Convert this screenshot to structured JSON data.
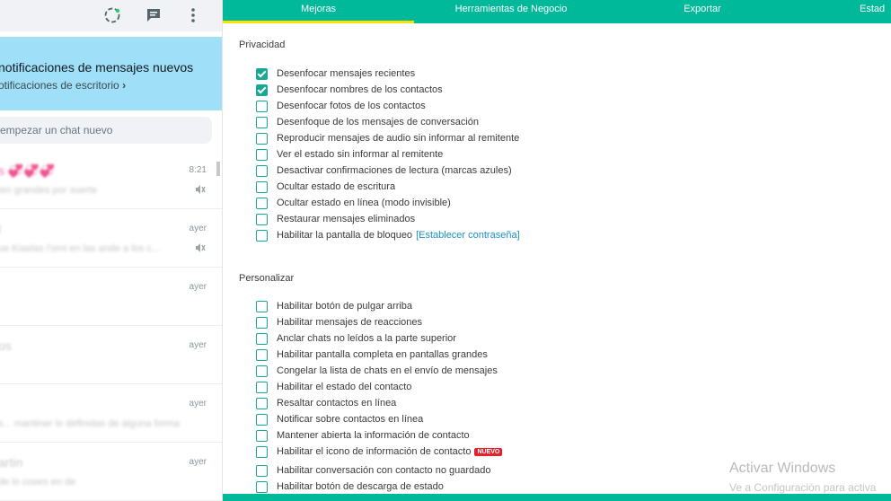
{
  "left": {
    "notification": {
      "title": "notificaciones de mensajes nuevos",
      "link": "otificaciones de escritorio",
      "chevron": "›"
    },
    "search": {
      "placeholder": "empezar un chat nuevo"
    },
    "chats": [
      {
        "name": "s 💞💞💞",
        "message": "ien grandes por suerte",
        "time": "8:21",
        "muted": true
      },
      {
        "name": "l",
        "message": "ue Kiaslas l'omi en las ande a los c... ",
        "time": "ayer",
        "muted": true
      },
      {
        "name": "",
        "message": "",
        "time": "ayer",
        "muted": false
      },
      {
        "name": "os",
        "message": "",
        "time": "ayer",
        "muted": false
      },
      {
        "name": "",
        "message": "s... mantiner lo definidas de alguna forma",
        "time": "ayer",
        "muted": false
      },
      {
        "name": "artin",
        "message": "de lo coses en de",
        "time": "ayer",
        "muted": false
      }
    ]
  },
  "tabs": [
    "Mejoras",
    "Herramientas de Negocio",
    "Exportar",
    "Estad"
  ],
  "privacidad": {
    "title": "Privacidad",
    "options": [
      {
        "label": "Desenfocar mensajes recientes",
        "checked": true
      },
      {
        "label": "Desenfocar nombres de los contactos",
        "checked": true
      },
      {
        "label": "Desenfocar fotos de los contactos",
        "checked": false
      },
      {
        "label": "Desenfoque de los mensajes de conversación",
        "checked": false
      },
      {
        "label": "Reproducir mensajes de audio sin informar al remitente",
        "checked": false
      },
      {
        "label": "Ver el estado sin informar al remitente",
        "checked": false
      },
      {
        "label": "Desactivar confirmaciones de lectura (marcas azules)",
        "checked": false
      },
      {
        "label": "Ocultar estado de escritura",
        "checked": false
      },
      {
        "label": "Ocultar estado en línea (modo invisible)",
        "checked": false
      },
      {
        "label": "Restaurar mensajes eliminados",
        "checked": false
      },
      {
        "label": "Habilitar la pantalla de bloqueo",
        "checked": false,
        "link": "[Establecer contraseña]"
      }
    ]
  },
  "personalizar": {
    "title": "Personalizar",
    "options": [
      {
        "label": "Habilitar botón de pulgar arriba",
        "checked": false
      },
      {
        "label": "Habilitar mensajes de reacciones",
        "checked": false
      },
      {
        "label": "Anclar chats no leídos a la parte superior",
        "checked": false
      },
      {
        "label": "Habilitar pantalla completa en pantallas grandes",
        "checked": false
      },
      {
        "label": "Congelar la lista de chats en el envío de mensajes",
        "checked": false
      },
      {
        "label": "Habilitar el estado del contacto",
        "checked": false
      },
      {
        "label": "Resaltar contactos en línea",
        "checked": false
      },
      {
        "label": "Notificar sobre contactos en línea",
        "checked": false
      },
      {
        "label": "Mantener abierta la información de contacto",
        "checked": false
      },
      {
        "label": "Habilitar el icono de información de contacto",
        "checked": false,
        "badge": "NUEVO"
      },
      {
        "label": "Habilitar conversación con contacto no guardado",
        "checked": false
      },
      {
        "label": "Habilitar botón de descarga de estado",
        "checked": false
      }
    ]
  },
  "windows": {
    "title": "Activar Windows",
    "subtitle": "Ve a Configuración para activa"
  },
  "colors": {
    "accent": "#00b89a",
    "notification_bg": "#9fdff7",
    "active_tab_underline": "#ffe000",
    "badge": "#e3222c"
  }
}
